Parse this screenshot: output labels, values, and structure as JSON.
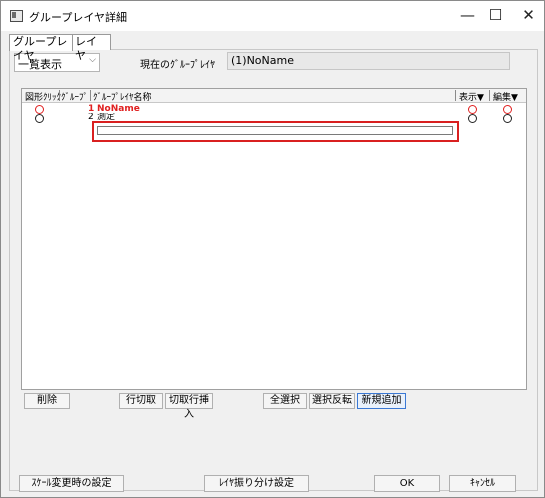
{
  "window": {
    "title": "グループレイヤ詳細",
    "minimize_glyph": "—",
    "maximize_glyph": "☐",
    "close_glyph": "✕"
  },
  "tabs": [
    {
      "label": "グループレイヤ",
      "active": true
    },
    {
      "label": "レイヤ",
      "active": false
    }
  ],
  "view_select": {
    "value": "一覧表示",
    "arrow": "⌵"
  },
  "current_group": {
    "label": "現在のｸﾞﾙｰﾌﾟﾚｲﾔ",
    "value": "(1)NoName"
  },
  "grid": {
    "columns": [
      "図形ｸﾘｯｸ",
      "ｸﾞﾙｰﾌﾟ",
      "ｸﾞﾙｰﾌﾟﾚｲﾔ名称",
      "表示▼",
      "編集▼"
    ],
    "rows": [
      {
        "number": "1",
        "name": "NoName",
        "selected": true
      },
      {
        "number": "2",
        "name": "測定",
        "selected": false
      }
    ]
  },
  "grid_buttons": {
    "delete": "削除",
    "cut_row": "行切取",
    "insert_cut_row": "切取行挿入",
    "select_all": "全選択",
    "invert_selection": "選択反転",
    "add_new": "新規追加"
  },
  "bottom_buttons": {
    "scale_change_settings": "ｽｹｰﾙ変更時の設定",
    "layer_assign_settings": "ﾚｲﾔ振り分け設定",
    "ok": "OK",
    "cancel": "ｷｬﾝｾﾙ"
  }
}
